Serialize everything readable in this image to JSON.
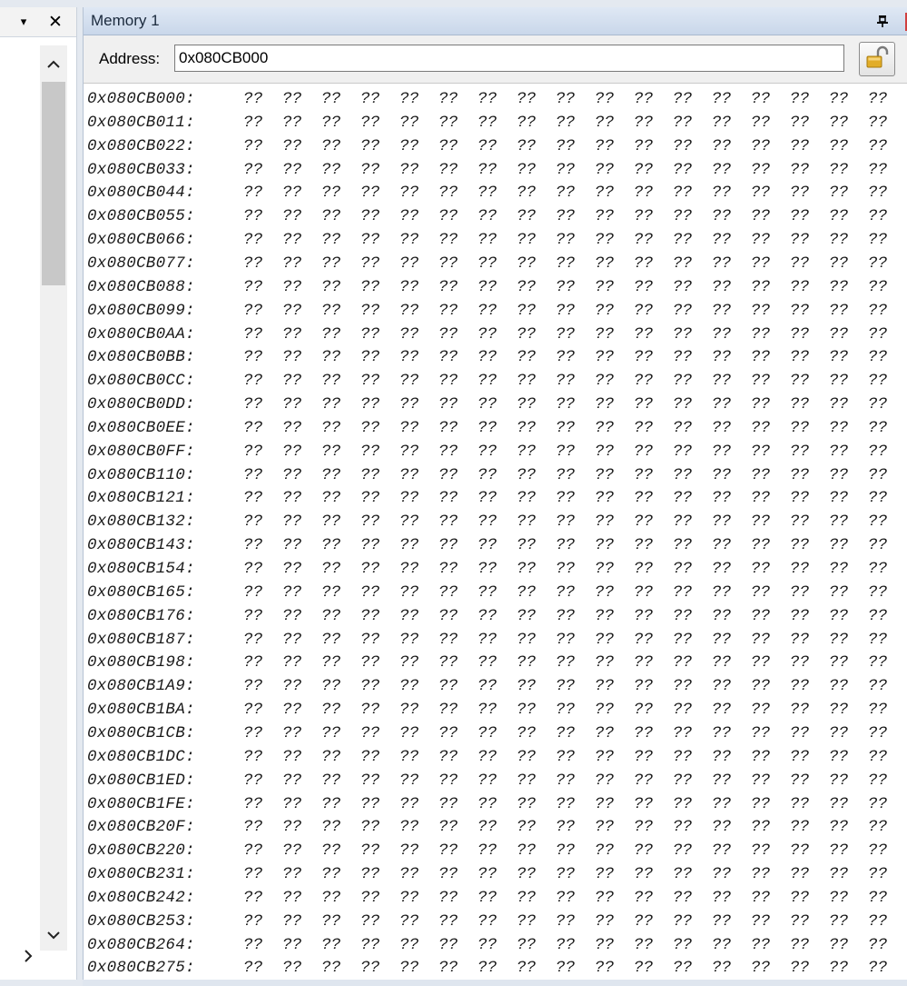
{
  "left_pane": {
    "dropdown_icon": "▾",
    "close_icon": "✕"
  },
  "memory_window": {
    "title": "Memory 1",
    "address_label": "Address:",
    "address_value": "0x080CB000",
    "rows": [
      {
        "address": "0x080CB000:",
        "bytes": [
          "??",
          "??",
          "??",
          "??",
          "??",
          "??",
          "??",
          "??",
          "??",
          "??",
          "??",
          "??",
          "??",
          "??",
          "??",
          "??",
          "??"
        ]
      },
      {
        "address": "0x080CB011:",
        "bytes": [
          "??",
          "??",
          "??",
          "??",
          "??",
          "??",
          "??",
          "??",
          "??",
          "??",
          "??",
          "??",
          "??",
          "??",
          "??",
          "??",
          "??"
        ]
      },
      {
        "address": "0x080CB022:",
        "bytes": [
          "??",
          "??",
          "??",
          "??",
          "??",
          "??",
          "??",
          "??",
          "??",
          "??",
          "??",
          "??",
          "??",
          "??",
          "??",
          "??",
          "??"
        ]
      },
      {
        "address": "0x080CB033:",
        "bytes": [
          "??",
          "??",
          "??",
          "??",
          "??",
          "??",
          "??",
          "??",
          "??",
          "??",
          "??",
          "??",
          "??",
          "??",
          "??",
          "??",
          "??"
        ]
      },
      {
        "address": "0x080CB044:",
        "bytes": [
          "??",
          "??",
          "??",
          "??",
          "??",
          "??",
          "??",
          "??",
          "??",
          "??",
          "??",
          "??",
          "??",
          "??",
          "??",
          "??",
          "??"
        ]
      },
      {
        "address": "0x080CB055:",
        "bytes": [
          "??",
          "??",
          "??",
          "??",
          "??",
          "??",
          "??",
          "??",
          "??",
          "??",
          "??",
          "??",
          "??",
          "??",
          "??",
          "??",
          "??"
        ]
      },
      {
        "address": "0x080CB066:",
        "bytes": [
          "??",
          "??",
          "??",
          "??",
          "??",
          "??",
          "??",
          "??",
          "??",
          "??",
          "??",
          "??",
          "??",
          "??",
          "??",
          "??",
          "??"
        ]
      },
      {
        "address": "0x080CB077:",
        "bytes": [
          "??",
          "??",
          "??",
          "??",
          "??",
          "??",
          "??",
          "??",
          "??",
          "??",
          "??",
          "??",
          "??",
          "??",
          "??",
          "??",
          "??"
        ]
      },
      {
        "address": "0x080CB088:",
        "bytes": [
          "??",
          "??",
          "??",
          "??",
          "??",
          "??",
          "??",
          "??",
          "??",
          "??",
          "??",
          "??",
          "??",
          "??",
          "??",
          "??",
          "??"
        ]
      },
      {
        "address": "0x080CB099:",
        "bytes": [
          "??",
          "??",
          "??",
          "??",
          "??",
          "??",
          "??",
          "??",
          "??",
          "??",
          "??",
          "??",
          "??",
          "??",
          "??",
          "??",
          "??"
        ]
      },
      {
        "address": "0x080CB0AA:",
        "bytes": [
          "??",
          "??",
          "??",
          "??",
          "??",
          "??",
          "??",
          "??",
          "??",
          "??",
          "??",
          "??",
          "??",
          "??",
          "??",
          "??",
          "??"
        ]
      },
      {
        "address": "0x080CB0BB:",
        "bytes": [
          "??",
          "??",
          "??",
          "??",
          "??",
          "??",
          "??",
          "??",
          "??",
          "??",
          "??",
          "??",
          "??",
          "??",
          "??",
          "??",
          "??"
        ]
      },
      {
        "address": "0x080CB0CC:",
        "bytes": [
          "??",
          "??",
          "??",
          "??",
          "??",
          "??",
          "??",
          "??",
          "??",
          "??",
          "??",
          "??",
          "??",
          "??",
          "??",
          "??",
          "??"
        ]
      },
      {
        "address": "0x080CB0DD:",
        "bytes": [
          "??",
          "??",
          "??",
          "??",
          "??",
          "??",
          "??",
          "??",
          "??",
          "??",
          "??",
          "??",
          "??",
          "??",
          "??",
          "??",
          "??"
        ]
      },
      {
        "address": "0x080CB0EE:",
        "bytes": [
          "??",
          "??",
          "??",
          "??",
          "??",
          "??",
          "??",
          "??",
          "??",
          "??",
          "??",
          "??",
          "??",
          "??",
          "??",
          "??",
          "??"
        ]
      },
      {
        "address": "0x080CB0FF:",
        "bytes": [
          "??",
          "??",
          "??",
          "??",
          "??",
          "??",
          "??",
          "??",
          "??",
          "??",
          "??",
          "??",
          "??",
          "??",
          "??",
          "??",
          "??"
        ]
      },
      {
        "address": "0x080CB110:",
        "bytes": [
          "??",
          "??",
          "??",
          "??",
          "??",
          "??",
          "??",
          "??",
          "??",
          "??",
          "??",
          "??",
          "??",
          "??",
          "??",
          "??",
          "??"
        ]
      },
      {
        "address": "0x080CB121:",
        "bytes": [
          "??",
          "??",
          "??",
          "??",
          "??",
          "??",
          "??",
          "??",
          "??",
          "??",
          "??",
          "??",
          "??",
          "??",
          "??",
          "??",
          "??"
        ]
      },
      {
        "address": "0x080CB132:",
        "bytes": [
          "??",
          "??",
          "??",
          "??",
          "??",
          "??",
          "??",
          "??",
          "??",
          "??",
          "??",
          "??",
          "??",
          "??",
          "??",
          "??",
          "??"
        ]
      },
      {
        "address": "0x080CB143:",
        "bytes": [
          "??",
          "??",
          "??",
          "??",
          "??",
          "??",
          "??",
          "??",
          "??",
          "??",
          "??",
          "??",
          "??",
          "??",
          "??",
          "??",
          "??"
        ]
      },
      {
        "address": "0x080CB154:",
        "bytes": [
          "??",
          "??",
          "??",
          "??",
          "??",
          "??",
          "??",
          "??",
          "??",
          "??",
          "??",
          "??",
          "??",
          "??",
          "??",
          "??",
          "??"
        ]
      },
      {
        "address": "0x080CB165:",
        "bytes": [
          "??",
          "??",
          "??",
          "??",
          "??",
          "??",
          "??",
          "??",
          "??",
          "??",
          "??",
          "??",
          "??",
          "??",
          "??",
          "??",
          "??"
        ]
      },
      {
        "address": "0x080CB176:",
        "bytes": [
          "??",
          "??",
          "??",
          "??",
          "??",
          "??",
          "??",
          "??",
          "??",
          "??",
          "??",
          "??",
          "??",
          "??",
          "??",
          "??",
          "??"
        ]
      },
      {
        "address": "0x080CB187:",
        "bytes": [
          "??",
          "??",
          "??",
          "??",
          "??",
          "??",
          "??",
          "??",
          "??",
          "??",
          "??",
          "??",
          "??",
          "??",
          "??",
          "??",
          "??"
        ]
      },
      {
        "address": "0x080CB198:",
        "bytes": [
          "??",
          "??",
          "??",
          "??",
          "??",
          "??",
          "??",
          "??",
          "??",
          "??",
          "??",
          "??",
          "??",
          "??",
          "??",
          "??",
          "??"
        ]
      },
      {
        "address": "0x080CB1A9:",
        "bytes": [
          "??",
          "??",
          "??",
          "??",
          "??",
          "??",
          "??",
          "??",
          "??",
          "??",
          "??",
          "??",
          "??",
          "??",
          "??",
          "??",
          "??"
        ]
      },
      {
        "address": "0x080CB1BA:",
        "bytes": [
          "??",
          "??",
          "??",
          "??",
          "??",
          "??",
          "??",
          "??",
          "??",
          "??",
          "??",
          "??",
          "??",
          "??",
          "??",
          "??",
          "??"
        ]
      },
      {
        "address": "0x080CB1CB:",
        "bytes": [
          "??",
          "??",
          "??",
          "??",
          "??",
          "??",
          "??",
          "??",
          "??",
          "??",
          "??",
          "??",
          "??",
          "??",
          "??",
          "??",
          "??"
        ]
      },
      {
        "address": "0x080CB1DC:",
        "bytes": [
          "??",
          "??",
          "??",
          "??",
          "??",
          "??",
          "??",
          "??",
          "??",
          "??",
          "??",
          "??",
          "??",
          "??",
          "??",
          "??",
          "??"
        ]
      },
      {
        "address": "0x080CB1ED:",
        "bytes": [
          "??",
          "??",
          "??",
          "??",
          "??",
          "??",
          "??",
          "??",
          "??",
          "??",
          "??",
          "??",
          "??",
          "??",
          "??",
          "??",
          "??"
        ]
      },
      {
        "address": "0x080CB1FE:",
        "bytes": [
          "??",
          "??",
          "??",
          "??",
          "??",
          "??",
          "??",
          "??",
          "??",
          "??",
          "??",
          "??",
          "??",
          "??",
          "??",
          "??",
          "??"
        ]
      },
      {
        "address": "0x080CB20F:",
        "bytes": [
          "??",
          "??",
          "??",
          "??",
          "??",
          "??",
          "??",
          "??",
          "??",
          "??",
          "??",
          "??",
          "??",
          "??",
          "??",
          "??",
          "??"
        ]
      },
      {
        "address": "0x080CB220:",
        "bytes": [
          "??",
          "??",
          "??",
          "??",
          "??",
          "??",
          "??",
          "??",
          "??",
          "??",
          "??",
          "??",
          "??",
          "??",
          "??",
          "??",
          "??"
        ]
      },
      {
        "address": "0x080CB231:",
        "bytes": [
          "??",
          "??",
          "??",
          "??",
          "??",
          "??",
          "??",
          "??",
          "??",
          "??",
          "??",
          "??",
          "??",
          "??",
          "??",
          "??",
          "??"
        ]
      },
      {
        "address": "0x080CB242:",
        "bytes": [
          "??",
          "??",
          "??",
          "??",
          "??",
          "??",
          "??",
          "??",
          "??",
          "??",
          "??",
          "??",
          "??",
          "??",
          "??",
          "??",
          "??"
        ]
      },
      {
        "address": "0x080CB253:",
        "bytes": [
          "??",
          "??",
          "??",
          "??",
          "??",
          "??",
          "??",
          "??",
          "??",
          "??",
          "??",
          "??",
          "??",
          "??",
          "??",
          "??",
          "??"
        ]
      },
      {
        "address": "0x080CB264:",
        "bytes": [
          "??",
          "??",
          "??",
          "??",
          "??",
          "??",
          "??",
          "??",
          "??",
          "??",
          "??",
          "??",
          "??",
          "??",
          "??",
          "??",
          "??"
        ]
      },
      {
        "address": "0x080CB275:",
        "bytes": [
          "??",
          "??",
          "??",
          "??",
          "??",
          "??",
          "??",
          "??",
          "??",
          "??",
          "??",
          "??",
          "??",
          "??",
          "??",
          "??",
          "??"
        ]
      }
    ]
  },
  "icons": {
    "pin": "pin-icon",
    "lock": "unlocked-padlock-icon",
    "scroll_up": "chevron-up-icon",
    "scroll_down": "chevron-down-icon",
    "scroll_right": "chevron-right-icon"
  },
  "colors": {
    "titlebar_accent": "#c9d7ea",
    "memory_text": "#1a1a1a",
    "padlock": "#d9a520"
  }
}
